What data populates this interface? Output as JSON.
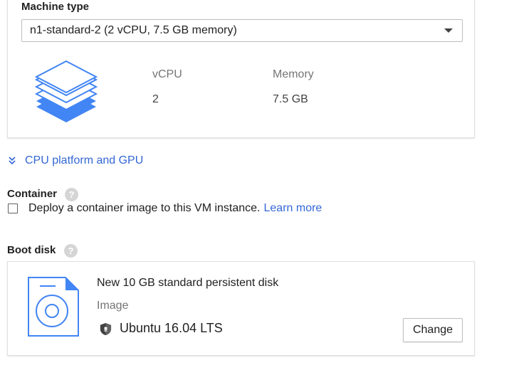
{
  "machine_type": {
    "label": "Machine type",
    "selected": "n1-standard-2 (2 vCPU, 7.5 GB memory)",
    "icon": "layers-stack-icon",
    "specs": {
      "vcpu_header": "vCPU",
      "vcpu_value": "2",
      "memory_header": "Memory",
      "memory_value": "7.5 GB"
    }
  },
  "cpu_platform_link": {
    "label": "CPU platform and GPU",
    "icon": "double-chevron-down-icon"
  },
  "container": {
    "label": "Container",
    "help_icon": "help-icon",
    "checkbox_checked": false,
    "checkbox_label": "Deploy a container image to this VM instance.",
    "learn_more": "Learn more"
  },
  "boot_disk": {
    "label": "Boot disk",
    "help_icon": "help-icon",
    "disk_icon": "disk-file-icon",
    "title": "New 10 GB standard persistent disk",
    "image_label": "Image",
    "os_icon": "shield-icon",
    "os": "Ubuntu 16.04 LTS",
    "change_button": "Change"
  },
  "colors": {
    "link_blue": "#3367d6",
    "stack_blue": "#4285f4",
    "border_gray": "#e0e0e0"
  }
}
